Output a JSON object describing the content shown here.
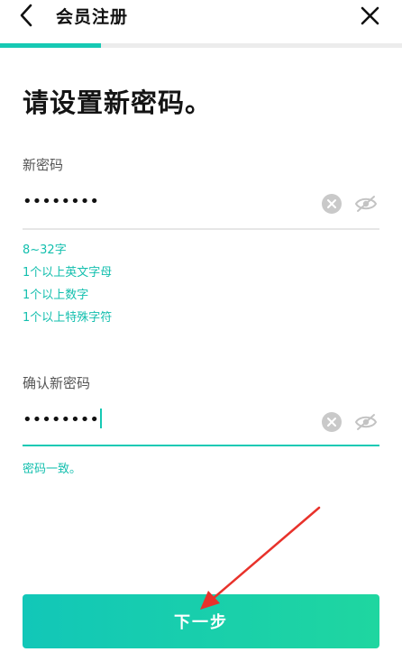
{
  "header": {
    "title": "会员注册",
    "back_icon": "chevron-left-icon",
    "close_icon": "close-icon"
  },
  "progress": {
    "fraction": 0.25,
    "color": "#16c9b4"
  },
  "main": {
    "title": "请设置新密码。",
    "new_password": {
      "label": "新密码",
      "value": "••••••••",
      "clear_icon": "clear-icon",
      "visibility_icon": "eye-off-icon"
    },
    "requirements": [
      "8~32字",
      "1个以上英文字母",
      "1个以上数字",
      "1个以上特殊字符"
    ],
    "confirm_password": {
      "label": "确认新密码",
      "value": "••••••••",
      "clear_icon": "clear-icon",
      "visibility_icon": "eye-off-icon"
    },
    "match_message": "密码一致。"
  },
  "footer": {
    "next_label": "下一步"
  },
  "colors": {
    "accent": "#16c9b4",
    "annotation_arrow": "#e8322b"
  }
}
